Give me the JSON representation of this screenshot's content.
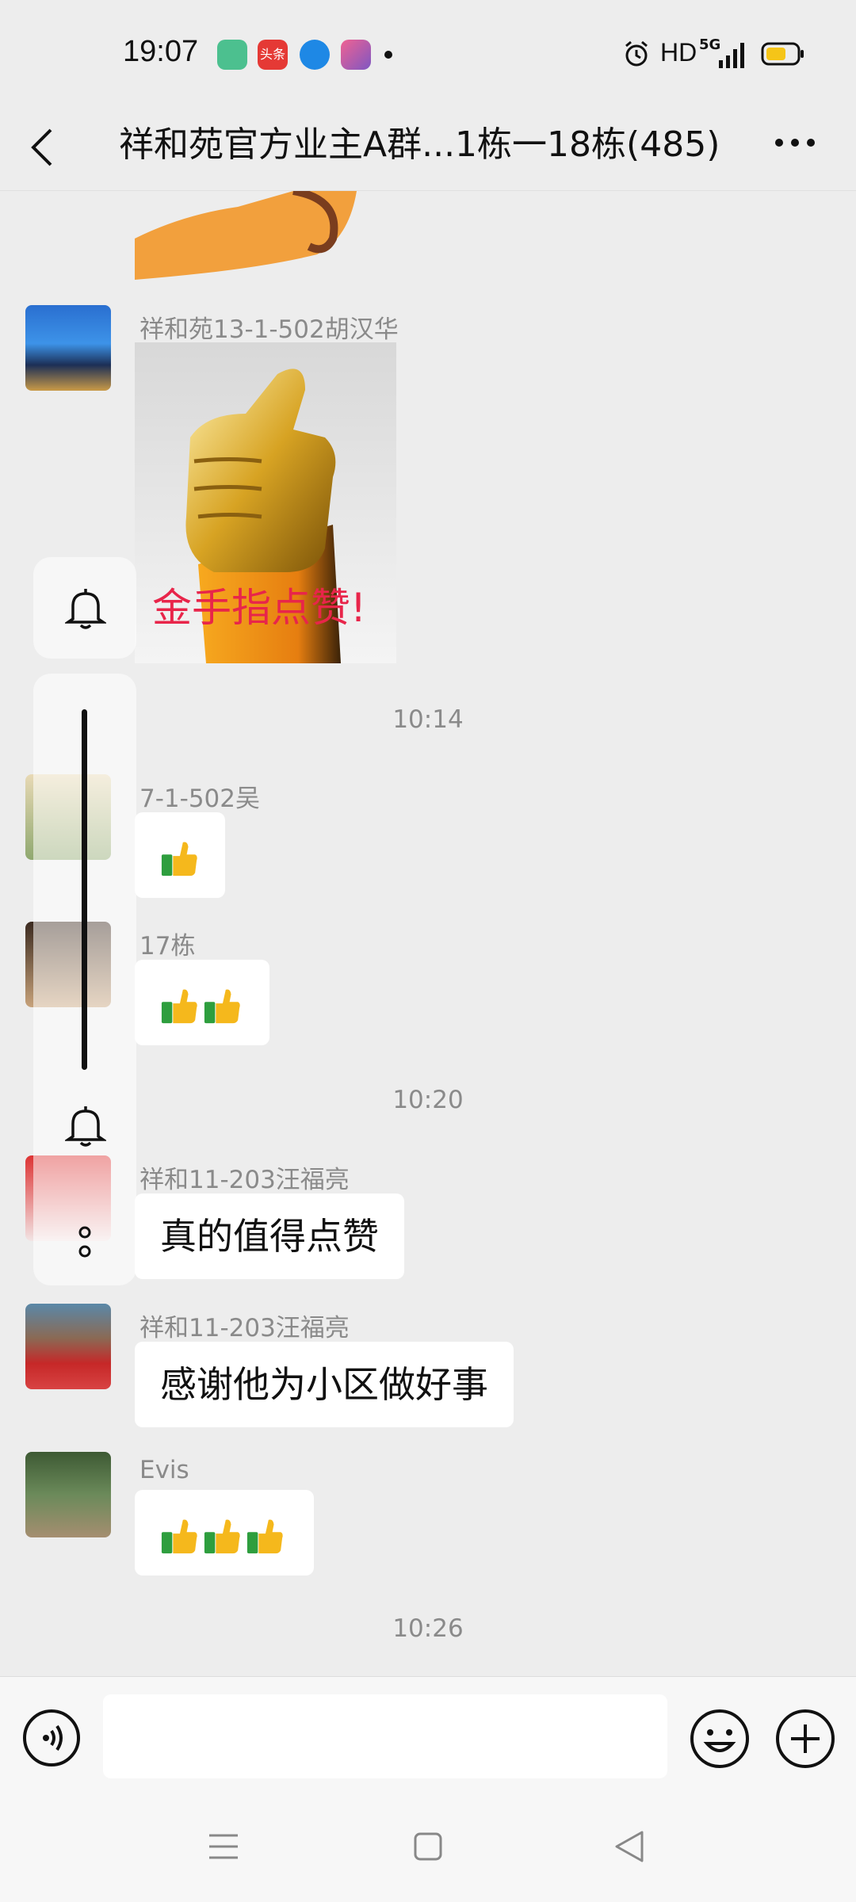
{
  "status_bar": {
    "time": "19:07",
    "news_app_label": "头条",
    "hd_label": "HD",
    "network_label": "5G",
    "apps": [
      "message-app-icon",
      "toutiao-app-icon",
      "browser-app-icon",
      "shortcut-app-icon"
    ]
  },
  "header": {
    "title": "祥和苑官方业主A群...1栋一18栋(485)"
  },
  "messages": [
    {
      "sender": "祥和苑13-1-502胡汉华",
      "image_caption": "金手指点赞!"
    },
    {
      "timestamp": "10:14"
    },
    {
      "sender": "7-1-502吴",
      "content": "👍"
    },
    {
      "sender": "17栋",
      "content": "👍👍"
    },
    {
      "timestamp": "10:20"
    },
    {
      "sender": "祥和11-203汪福亮",
      "content": "真的值得点赞"
    },
    {
      "sender": "祥和11-203汪福亮",
      "content": "感谢他为小区做好事"
    },
    {
      "sender": "Evis",
      "content": "👍👍👍"
    },
    {
      "timestamp": "10:26"
    }
  ],
  "input": {
    "value": "",
    "placeholder": ""
  },
  "colors": {
    "background": "#ededed",
    "bubble": "#ffffff",
    "caption_red": "#e8254a",
    "thumb_yellow": "#f5b81c",
    "thumb_green": "#2e9e3e"
  }
}
